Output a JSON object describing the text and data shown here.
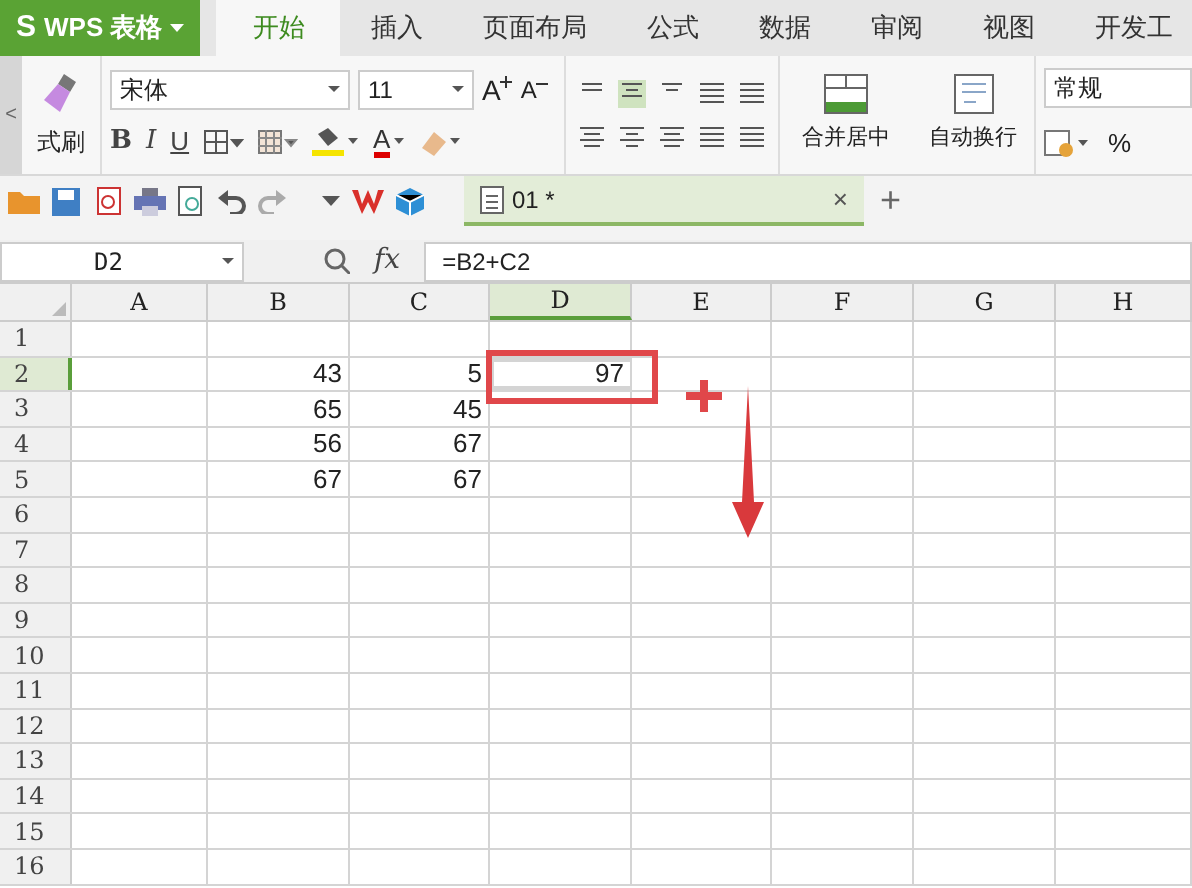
{
  "app_menu": {
    "logo": "S",
    "label": "WPS 表格"
  },
  "tabs": [
    {
      "label": "开始",
      "selected": true
    },
    {
      "label": "插入",
      "selected": false
    },
    {
      "label": "页面布局",
      "selected": false
    },
    {
      "label": "公式",
      "selected": false
    },
    {
      "label": "数据",
      "selected": false
    },
    {
      "label": "审阅",
      "selected": false
    },
    {
      "label": "视图",
      "selected": false
    },
    {
      "label": "开发工",
      "selected": false
    }
  ],
  "ribbon": {
    "collapse": "<",
    "format_painter": "式刷",
    "font_name": "宋体",
    "font_size": "11",
    "grow_font": "A",
    "shrink_font": "A",
    "bold": "B",
    "italic": "I",
    "underline": "U",
    "font_color": "A",
    "merge_center": "合并居中",
    "wrap_text": "自动换行",
    "number_format": "常规",
    "percent": "%"
  },
  "document_tab": {
    "title": "01 *",
    "close": "×",
    "new_tab": "+"
  },
  "formula_bar": {
    "name_box": "D2",
    "fx": "fx",
    "formula": "=B2+C2"
  },
  "columns": [
    {
      "label": "A",
      "selected": false
    },
    {
      "label": "B",
      "selected": false
    },
    {
      "label": "C",
      "selected": false
    },
    {
      "label": "D",
      "selected": true
    },
    {
      "label": "E",
      "selected": false
    },
    {
      "label": "F",
      "selected": false
    },
    {
      "label": "G",
      "selected": false
    },
    {
      "label": "H",
      "selected": false
    }
  ],
  "rows": [
    {
      "label": "1",
      "selected": false
    },
    {
      "label": "2",
      "selected": true,
      "b": "43",
      "c": "5",
      "d": "97"
    },
    {
      "label": "3",
      "selected": false,
      "b": "65",
      "c": "45"
    },
    {
      "label": "4",
      "selected": false,
      "b": "56",
      "c": "67"
    },
    {
      "label": "5",
      "selected": false,
      "b": "67",
      "c": "67"
    },
    {
      "label": "6",
      "selected": false
    },
    {
      "label": "7",
      "selected": false
    },
    {
      "label": "8",
      "selected": false
    },
    {
      "label": "9",
      "selected": false
    },
    {
      "label": "10",
      "selected": false
    },
    {
      "label": "11",
      "selected": false
    },
    {
      "label": "12",
      "selected": false
    },
    {
      "label": "13",
      "selected": false
    },
    {
      "label": "14",
      "selected": false
    },
    {
      "label": "15",
      "selected": false
    },
    {
      "label": "16",
      "selected": false
    }
  ],
  "annotations": [
    {
      "kind": "box"
    },
    {
      "kind": "plus"
    },
    {
      "kind": "arrow"
    }
  ]
}
